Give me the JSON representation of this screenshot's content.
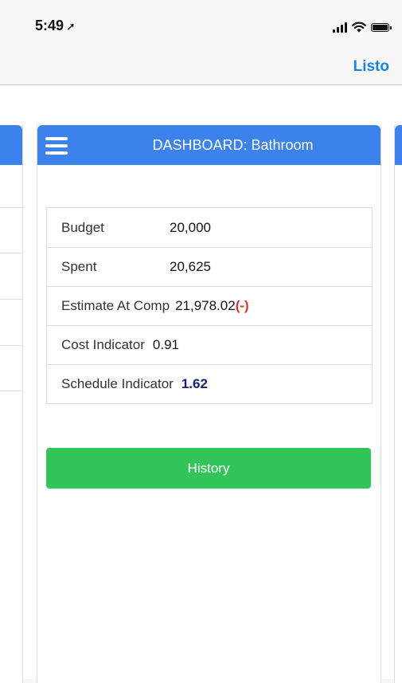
{
  "status_bar": {
    "time": "5:49",
    "location_icon": "location-arrow-icon",
    "icons": [
      "signal-icon",
      "wifi-icon",
      "battery-icon"
    ]
  },
  "nav": {
    "done_label": "Listo"
  },
  "card": {
    "title": "DASHBOARD: Bathroom",
    "menu_icon": "hamburger-menu-icon"
  },
  "kpis": {
    "budget": {
      "label": "Budget",
      "value": "20,000"
    },
    "spent": {
      "label": "Spent",
      "value": "20,625"
    },
    "estimate": {
      "label": "Estimate At Comp",
      "value": "21,978.02",
      "flag": "(-)"
    },
    "cost_indicator": {
      "label": "Cost Indicator",
      "value": "0.91"
    },
    "schedule_indicator": {
      "label": "Schedule Indicator",
      "value": "1.62"
    }
  },
  "actions": {
    "history_label": "History"
  },
  "colors": {
    "accent": "#3b82ec",
    "link": "#1a82e8",
    "success": "#33c45a",
    "warning": "#e0312b",
    "indicator_good": "#16207a"
  }
}
